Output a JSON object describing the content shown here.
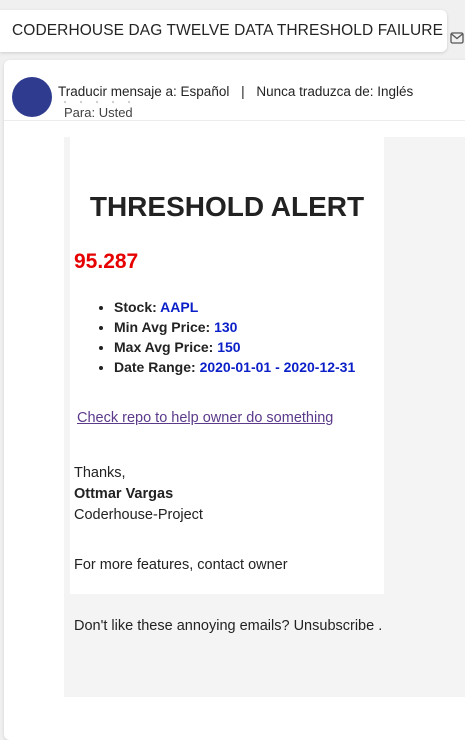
{
  "subject": {
    "title": "CODERHOUSE DAG TWELVE DATA THRESHOLD FAILURE",
    "action_icon": "mail-check-icon"
  },
  "translate": {
    "icon": "translate-icon",
    "translate_label": "Traducir mensaje a: Español",
    "separator": "|",
    "never_label": "Nunca traduzca de: Inglés"
  },
  "message": {
    "avatar_color": "#2e3b8f",
    "to_label": "Para:",
    "to_value": "Usted"
  },
  "email": {
    "heading": "THRESHOLD ALERT",
    "value": "95.287",
    "value_color": "#e60000",
    "value_blue": "#0a1fc7",
    "details": [
      {
        "label": "Stock:",
        "value": "AAPL"
      },
      {
        "label": "Min Avg Price:",
        "value": "130"
      },
      {
        "label": "Max Avg Price:",
        "value": "150"
      },
      {
        "label": "Date Range:",
        "value": "2020-01-01 - 2020-12-31"
      }
    ],
    "repo_link": "Check repo to help owner do something",
    "thanks": "Thanks,",
    "signature_name": "Ottmar Vargas",
    "signature_org": "Coderhouse-Project",
    "features_text": "For more features, contact owner",
    "unsubscribe_text": "Don't like these annoying emails? Unsubscribe ."
  }
}
